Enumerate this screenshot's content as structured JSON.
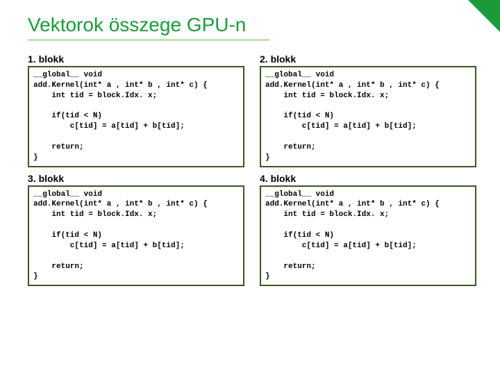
{
  "title": "Vektorok összege GPU-n",
  "blocks": {
    "b1": {
      "label": "1. blokk"
    },
    "b2": {
      "label": "2. blokk"
    },
    "b3": {
      "label": "3. blokk"
    },
    "b4": {
      "label": "4. blokk"
    }
  },
  "code": "__global__ void\nadd.Kernel(int* a , int* b , int* c) {\n    int tid = block.Idx. x;\n\n    if(tid < N)\n        c[tid] = a[tid] + b[tid];\n\n    return;\n}"
}
